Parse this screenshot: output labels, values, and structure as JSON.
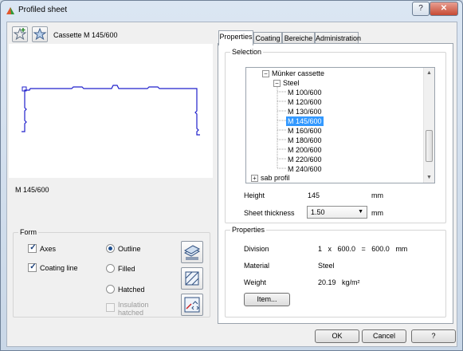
{
  "window": {
    "title": "Profiled sheet",
    "help_glyph": "?",
    "close_glyph": "✕"
  },
  "toolbar": {
    "profile_name": "Cassette M 145/600",
    "star_add_icon": "star-add-icon",
    "star_icon": "star-icon"
  },
  "preview": {
    "caption": "M 145/600"
  },
  "form": {
    "legend": "Form",
    "axes": {
      "label": "Axes",
      "checked": true
    },
    "coating_line": {
      "label": "Coating line",
      "checked": true
    },
    "outline": {
      "label": "Outline",
      "selected": true
    },
    "filled": {
      "label": "Filled",
      "selected": false
    },
    "hatched": {
      "label": "Hatched",
      "selected": false
    },
    "insulation_hatched": {
      "label_line1": "Insulation",
      "label_line2": "hatched",
      "checked": false,
      "enabled": false
    }
  },
  "tabs": [
    {
      "label": "Properties",
      "active": true
    },
    {
      "label": "Coating",
      "active": false
    },
    {
      "label": "Bereiche",
      "active": false
    },
    {
      "label": "Administration",
      "active": false
    }
  ],
  "selection": {
    "legend": "Selection",
    "tree": {
      "cassette": "Münker cassette",
      "steel": "Steel",
      "items": [
        "M 100/600",
        "M 120/600",
        "M 130/600",
        "M 145/600",
        "M 160/600",
        "M 180/600",
        "M 200/600",
        "M 220/600",
        "M 240/600"
      ],
      "selected": "M 145/600",
      "other": "sab profil"
    },
    "height_label": "Height",
    "height_value": "145",
    "height_unit": "mm",
    "thickness_label": "Sheet thickness",
    "thickness_value": "1.50",
    "thickness_unit": "mm"
  },
  "properties": {
    "legend": "Properties",
    "division_label": "Division",
    "division_value": "1   x   600.0   =   600.0   mm",
    "material_label": "Material",
    "material_value": "Steel",
    "weight_label": "Weight",
    "weight_value": "20.19   kg/m²",
    "item_button": "Item..."
  },
  "footer": {
    "ok": "OK",
    "cancel": "Cancel",
    "help": "?"
  }
}
